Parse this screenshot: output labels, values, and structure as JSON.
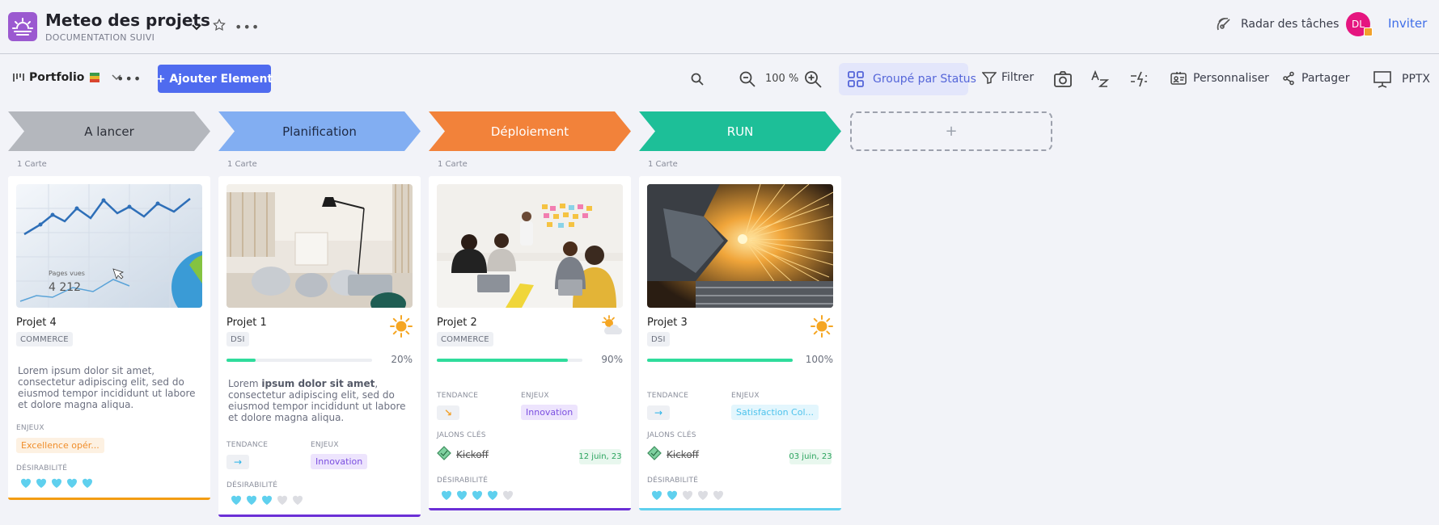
{
  "header": {
    "title": "Meteo des projets",
    "subtitle": "DOCUMENTATION SUIVI",
    "radar_label": "Radar des tâches",
    "avatar_initials": "DL",
    "invite_label": "Inviter"
  },
  "toolbar": {
    "portfolio_label": "Portfolio",
    "add_label": "+ Ajouter Element",
    "zoom": "100 %",
    "grouped_label": "Groupé par Status",
    "filter_label": "Filtrer",
    "customize_label": "Personnaliser",
    "share_label": "Partager",
    "pptx_label": "PPTX",
    "add_column": "+"
  },
  "labels": {
    "tendance": "TENDANCE",
    "enjeux": "ENJEUX",
    "jalons": "JALONS CLÉS",
    "desirabilite": "DÉSIRABILITÉ"
  },
  "columns": [
    {
      "name": "A lancer",
      "count": "1 Carte",
      "color": "#b4b7bd"
    },
    {
      "name": "Planification",
      "count": "1 Carte",
      "color": "#82aef2"
    },
    {
      "name": "Déploiement",
      "count": "1 Carte",
      "color": "#f2823a"
    },
    {
      "name": "RUN",
      "count": "1 Carte",
      "color": "#1dbf98"
    }
  ],
  "cards": [
    {
      "name": "Projet 4",
      "tag": "COMMERCE",
      "image_text": "Pages vues",
      "image_number": "4 212",
      "description": "Lorem ipsum dolor sit amet, consectetur adipiscing elit, sed do eiusmod tempor incididunt ut labore et dolore magna aliqua.",
      "enjeux": "Excellence opér...",
      "hearts": 5,
      "bottom_color": "#f39c12"
    },
    {
      "name": "Projet 1",
      "tag": "DSI",
      "weather": "sun-icon",
      "progress": 20,
      "progress_label": "20%",
      "desc_pre": "Lorem ",
      "desc_bold": "ipsum dolor sit amet",
      "desc_post": ", consectetur adipiscing elit, sed do eiusmod tempor incididunt ut labore et dolore magna aliqua.",
      "tendance": "→",
      "enjeux": "Innovation",
      "hearts": 3,
      "bottom_color": "#6b2fd6"
    },
    {
      "name": "Projet 2",
      "tag": "COMMERCE",
      "weather": "sun-cloud-icon",
      "progress": 90,
      "progress_label": "90%",
      "tendance": "↘",
      "enjeux": "Innovation",
      "milestone": "Kickoff",
      "milestone_date": "12 juin, 23",
      "hearts": 4,
      "bottom_color": "#6b2fd6"
    },
    {
      "name": "Projet 3",
      "tag": "DSI",
      "weather": "sun-icon",
      "progress": 100,
      "progress_label": "100%",
      "tendance": "→",
      "enjeux": "Satisfaction Col...",
      "milestone": "Kickoff",
      "milestone_date": "03 juin, 23",
      "hearts": 2,
      "bottom_color": "#5fd0ee"
    }
  ]
}
